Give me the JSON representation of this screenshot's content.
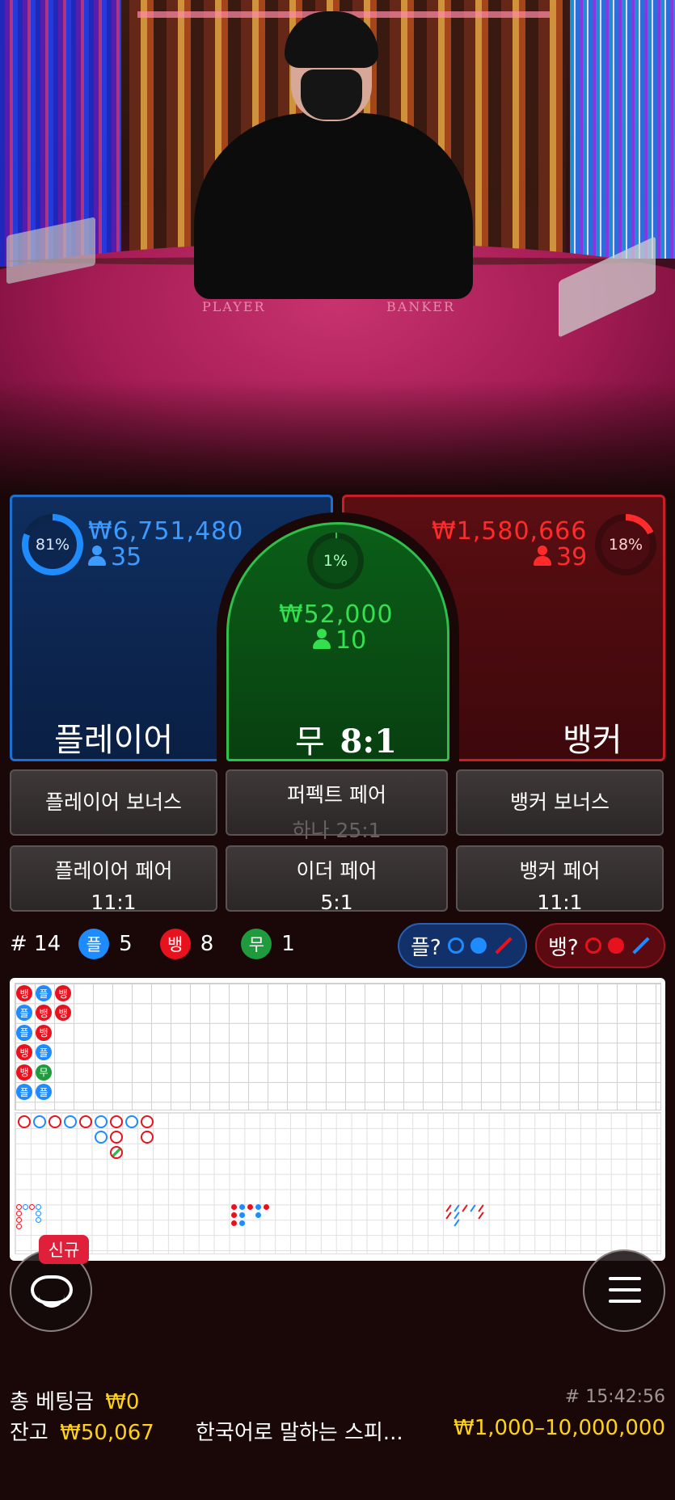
{
  "video": {
    "table_left": "PLAYER",
    "table_right": "BANKER"
  },
  "player": {
    "percent": "81%",
    "amount": "₩6,751,480",
    "count": "35",
    "label": "플레이어"
  },
  "tie": {
    "percent": "1%",
    "amount": "₩52,000",
    "count": "10",
    "label": "무",
    "payout": "8:1"
  },
  "banker": {
    "percent": "18%",
    "amount": "₩1,580,666",
    "count": "39",
    "label": "뱅커"
  },
  "side_bets": {
    "player_bonus": "플레이어 보너스",
    "perfect_pair": "퍼펙트 페어",
    "perfect_pair_odds": "하나 25:1",
    "banker_bonus": "뱅커 보너스",
    "player_pair": "플레이어 페어",
    "player_pair_odds": "11:1",
    "either_pair": "이더 페어",
    "either_pair_odds": "5:1",
    "banker_pair": "뱅커 페어",
    "banker_pair_odds": "11:1"
  },
  "stats": {
    "round": "# 14",
    "player_chip": "플",
    "player_count": "5",
    "banker_chip": "뱅",
    "banker_count": "8",
    "tie_chip": "무",
    "tie_count": "1",
    "player_predict": "플?",
    "banker_predict": "뱅?"
  },
  "roadmap": {
    "bead_plate": [
      [
        "뱅",
        "플",
        "플",
        "뱅",
        "뱅",
        "플"
      ],
      [
        "플",
        "뱅",
        "뱅",
        "플",
        "무",
        "플"
      ],
      [
        "뱅",
        "뱅"
      ]
    ]
  },
  "badges": {
    "new": "신규"
  },
  "footer": {
    "total_bet_label": "총 베팅금",
    "total_bet_value": "₩0",
    "balance_label": "잔고",
    "balance_value": "₩50,067",
    "time": "# 15:42:56",
    "table_name": "한국어로 말하는 스피...",
    "limit": "₩1,000–10,000,000"
  },
  "colors": {
    "player": "#1e8bff",
    "banker": "#e8121f",
    "tie": "#20c040",
    "gold": "#ffd21a"
  },
  "icons": {
    "chat": "chat-icon",
    "menu": "menu-icon",
    "person": "person-icon"
  }
}
